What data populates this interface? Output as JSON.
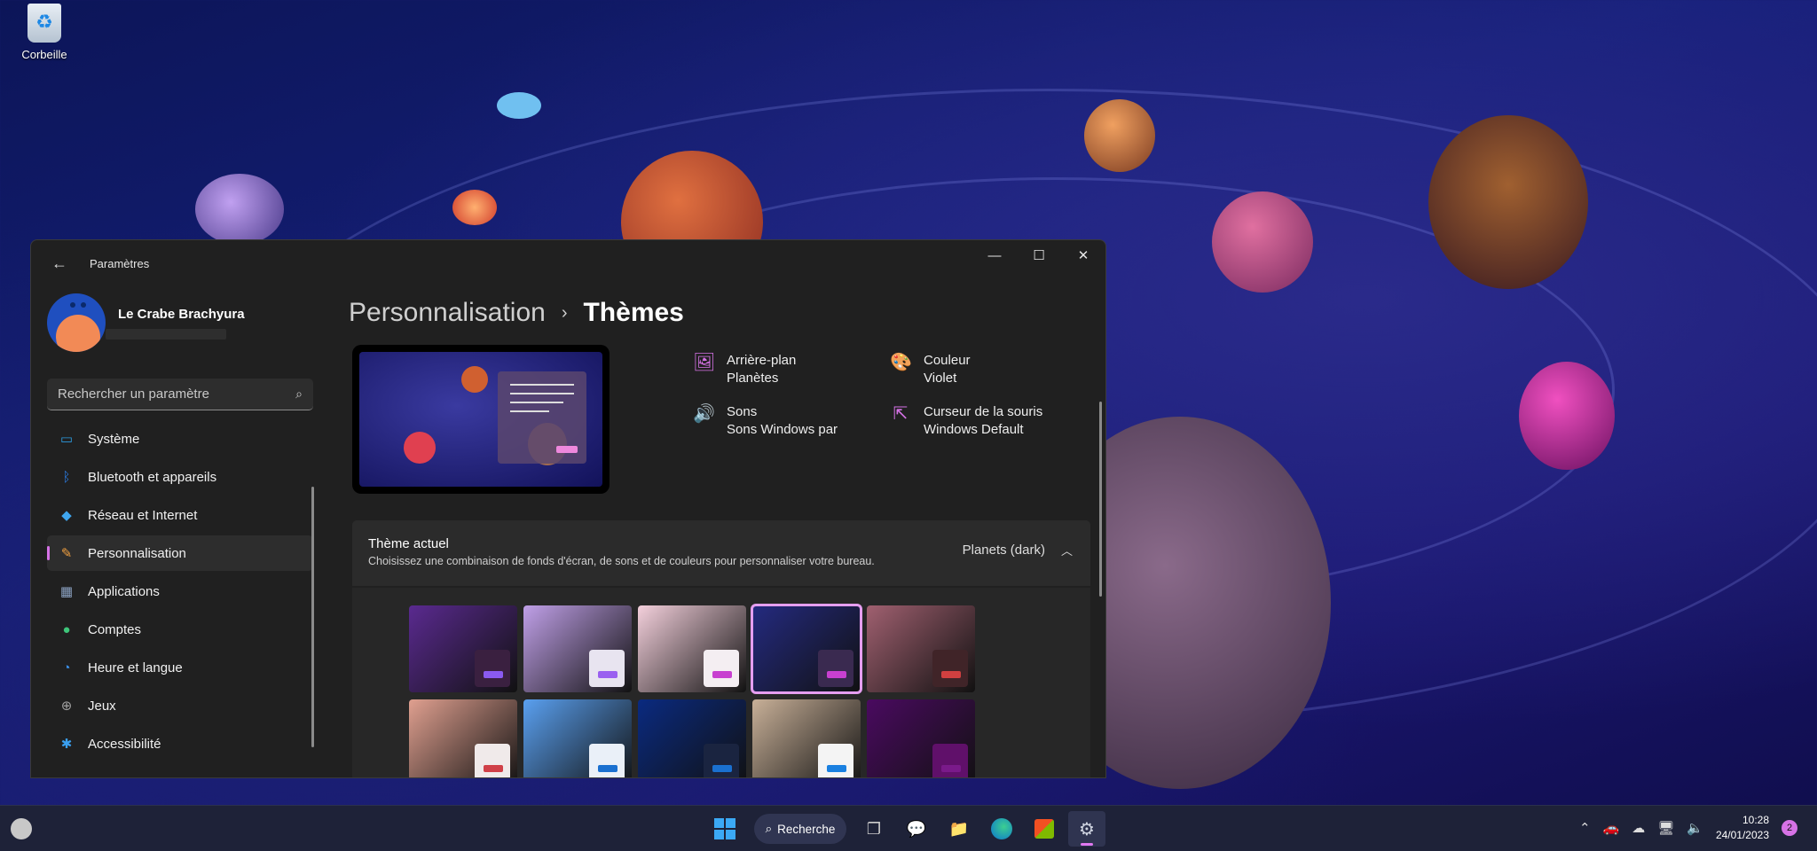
{
  "desktop": {
    "recycle_bin_label": "Corbeille"
  },
  "window": {
    "title": "Paramètres",
    "back_icon": "arrow-left-icon",
    "minimize_icon": "minimize-icon",
    "maximize_icon": "maximize-icon",
    "close_icon": "close-icon"
  },
  "profile": {
    "name": "Le Crabe Brachyura"
  },
  "search": {
    "placeholder": "Rechercher un paramètre",
    "icon": "search-icon"
  },
  "sidebar": {
    "items": [
      {
        "label": "Système",
        "icon": "system-icon",
        "color": "#2b9be0"
      },
      {
        "label": "Bluetooth et appareils",
        "icon": "bluetooth-icon",
        "color": "#2b7be0"
      },
      {
        "label": "Réseau et Internet",
        "icon": "network-icon",
        "color": "#3fa6ef"
      },
      {
        "label": "Personnalisation",
        "icon": "brush-icon",
        "color": "#f0a040",
        "active": true
      },
      {
        "label": "Applications",
        "icon": "apps-icon",
        "color": "#8aa0c0"
      },
      {
        "label": "Comptes",
        "icon": "accounts-icon",
        "color": "#3ec57a"
      },
      {
        "label": "Heure et langue",
        "icon": "time-language-icon",
        "color": "#3a8ee6"
      },
      {
        "label": "Jeux",
        "icon": "gaming-icon",
        "color": "#a0a0a0"
      },
      {
        "label": "Accessibilité",
        "icon": "accessibility-icon",
        "color": "#3aa0f0"
      }
    ]
  },
  "main": {
    "breadcrumb_parent": "Personnalisation",
    "breadcrumb_current": "Thèmes",
    "properties": {
      "background": {
        "label": "Arrière-plan",
        "value": "Planètes",
        "icon": "image-icon"
      },
      "color": {
        "label": "Couleur",
        "value": "Violet",
        "icon": "palette-icon"
      },
      "sounds": {
        "label": "Sons",
        "value": "Sons Windows par",
        "icon": "speaker-icon"
      },
      "cursor": {
        "label": "Curseur de la souris",
        "value": "Windows Default",
        "icon": "cursor-icon"
      }
    },
    "current_theme": {
      "title": "Thème actuel",
      "description": "Choisissez une combinaison de fonds d'écran, de sons et de couleurs pour personnaliser votre bureau.",
      "value": "Planets (dark)"
    },
    "themes": [
      {
        "name": "glow-dark",
        "bg": "#5a2a90",
        "box": "#3a2040",
        "bar": "#8a5af0"
      },
      {
        "name": "glow-light",
        "bg": "#c0a0e8",
        "box": "#e8e4f0",
        "bar": "#9a60f0"
      },
      {
        "name": "planets-light",
        "bg": "#f4d0dc",
        "box": "#f4eef2",
        "bar": "#c840d0"
      },
      {
        "name": "planets-dark",
        "bg": "#242a80",
        "box": "#3a2a50",
        "bar": "#c840d0",
        "selected": true
      },
      {
        "name": "sunrise-dark",
        "bg": "#a06070",
        "box": "#402428",
        "bar": "#d04040"
      },
      {
        "name": "sunrise-light",
        "bg": "#e0a090",
        "box": "#f0eaea",
        "bar": "#d04048"
      },
      {
        "name": "bloom-light",
        "bg": "#5aa0f0",
        "box": "#eaf0f8",
        "bar": "#1a70d0"
      },
      {
        "name": "bloom-dark",
        "bg": "#0a2a80",
        "box": "#1a2440",
        "bar": "#1a70d0"
      },
      {
        "name": "spotlight",
        "bg": "#c8b098",
        "box": "#f4f4f4",
        "bar": "#1a80e0"
      },
      {
        "name": "flow-dark",
        "bg": "#4a0a60",
        "box": "#60106a",
        "bar": "#7a1a8a"
      }
    ]
  },
  "taskbar": {
    "search_label": "Recherche",
    "search_icon": "search-icon",
    "apps": [
      "start-icon",
      "task-view-icon",
      "chat-icon",
      "file-explorer-icon",
      "edge-icon",
      "store-icon",
      "settings-icon"
    ],
    "tray_icons": [
      "chevron-up-icon",
      "car-icon",
      "onedrive-icon",
      "network-icon",
      "volume-icon"
    ],
    "time": "10:28",
    "date": "24/01/2023",
    "notification_count": "2"
  }
}
